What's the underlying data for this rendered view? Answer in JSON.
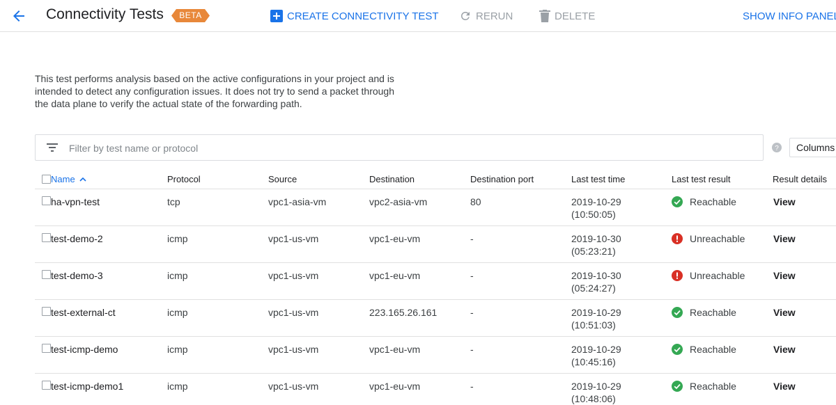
{
  "header": {
    "title": "Connectivity Tests",
    "badge": "BETA",
    "create_label": "CREATE CONNECTIVITY TEST",
    "rerun_label": "RERUN",
    "delete_label": "DELETE",
    "info_label": "SHOW INFO PANEL"
  },
  "description": "This test performs analysis based on the active configurations in your project and is intended to detect any configuration issues. It does not try to send a packet through the data plane to verify the actual state of the forwarding path.",
  "filter": {
    "placeholder": "Filter by test name or protocol"
  },
  "columns_label": "Columns",
  "table": {
    "headers": {
      "name": "Name",
      "protocol": "Protocol",
      "source": "Source",
      "destination": "Destination",
      "port": "Destination port",
      "time": "Last test time",
      "result": "Last test result",
      "details": "Result details"
    },
    "rows": [
      {
        "name": "ha-vpn-test",
        "protocol": "tcp",
        "source": "vpc1-asia-vm",
        "destination": "vpc2-asia-vm",
        "port": "80",
        "date": "2019-10-29",
        "time": "(10:50:05)",
        "result": "Reachable",
        "status": "ok",
        "details": "View"
      },
      {
        "name": "test-demo-2",
        "protocol": "icmp",
        "source": "vpc1-us-vm",
        "destination": "vpc1-eu-vm",
        "port": "-",
        "date": "2019-10-30",
        "time": "(05:23:21)",
        "result": "Unreachable",
        "status": "error",
        "details": "View"
      },
      {
        "name": "test-demo-3",
        "protocol": "icmp",
        "source": "vpc1-us-vm",
        "destination": "vpc1-eu-vm",
        "port": "-",
        "date": "2019-10-30",
        "time": "(05:24:27)",
        "result": "Unreachable",
        "status": "error",
        "details": "View"
      },
      {
        "name": "test-external-ct",
        "protocol": "icmp",
        "source": "vpc1-us-vm",
        "destination": "223.165.26.161",
        "port": "-",
        "date": "2019-10-29",
        "time": "(10:51:03)",
        "result": "Reachable",
        "status": "ok",
        "details": "View"
      },
      {
        "name": "test-icmp-demo",
        "protocol": "icmp",
        "source": "vpc1-us-vm",
        "destination": "vpc1-eu-vm",
        "port": "-",
        "date": "2019-10-29",
        "time": "(10:45:16)",
        "result": "Reachable",
        "status": "ok",
        "details": "View"
      },
      {
        "name": "test-icmp-demo1",
        "protocol": "icmp",
        "source": "vpc1-us-vm",
        "destination": "vpc1-eu-vm",
        "port": "-",
        "date": "2019-10-29",
        "time": "(10:48:06)",
        "result": "Reachable",
        "status": "ok",
        "details": "View"
      }
    ]
  },
  "colors": {
    "accent": "#1a73e8",
    "beta": "#e8883a",
    "success": "#34a853",
    "error": "#d93025",
    "disabled": "#9aa0a6"
  },
  "icons": {
    "back": "arrow-back-icon",
    "create": "add-box-icon",
    "rerun": "refresh-icon",
    "delete": "trash-icon",
    "filter": "filter-list-icon",
    "help": "help-icon",
    "sort": "arrow-up-icon",
    "ok": "check-circle-icon",
    "error": "error-circle-icon"
  }
}
